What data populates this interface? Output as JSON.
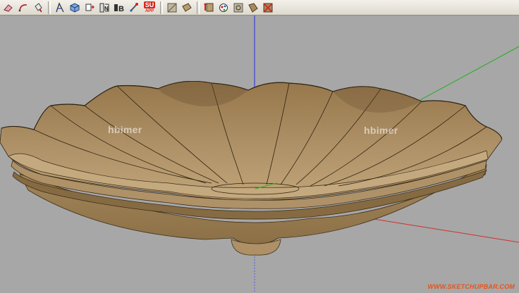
{
  "toolbar": {
    "tools": [
      {
        "name": "eraser-icon"
      },
      {
        "name": "arc-icon"
      },
      {
        "name": "paint-bucket-icon"
      },
      {
        "name": "line-tool-icon"
      },
      {
        "name": "rectangle-cube-icon"
      },
      {
        "name": "move-icon"
      },
      {
        "name": "components-icon"
      },
      {
        "name": "layers-icon"
      },
      {
        "name": "measure-icon"
      },
      {
        "name": "su-app-icon"
      },
      {
        "name": "edit-face-icon"
      },
      {
        "name": "texture-icon"
      },
      {
        "name": "pin-icon"
      },
      {
        "name": "materials-icon"
      },
      {
        "name": "position-texture-icon"
      },
      {
        "name": "rotate-texture-icon"
      },
      {
        "name": "no-texture-icon"
      }
    ],
    "su_label": "SU",
    "app_label": "APP"
  },
  "watermarks": {
    "left": "hbimer",
    "right": "hbimer"
  },
  "site_credit": "WWW.SKETCHUPBAR.COM",
  "colors": {
    "background": "#a7a7a7",
    "model_fill": "#a88a5c",
    "model_dark": "#7d6340",
    "axis_blue": "#2a2ae0",
    "axis_green": "#22b022",
    "axis_red": "#d03030",
    "credit": "#e5541b"
  }
}
